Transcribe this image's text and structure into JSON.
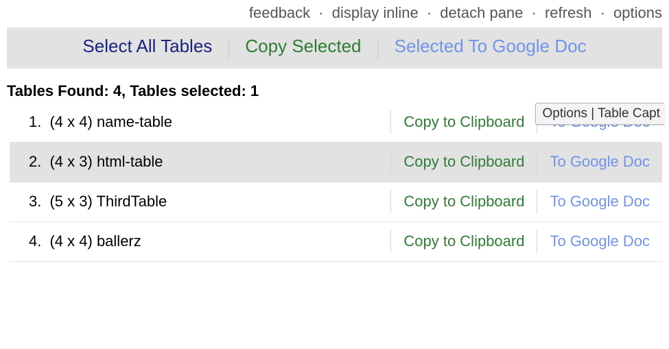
{
  "top_links": {
    "feedback": "feedback",
    "display_inline": "display inline",
    "detach_pane": "detach pane",
    "refresh": "refresh",
    "options": "options",
    "separator": "·"
  },
  "action_bar": {
    "select_all": "Select All Tables",
    "copy_selected": "Copy Selected",
    "to_google_doc": "Selected To Google Doc"
  },
  "status_text": "Tables Found: 4, Tables selected: 1",
  "row_action_labels": {
    "copy": "Copy to Clipboard",
    "gdoc": "To Google Doc"
  },
  "rows": [
    {
      "num": "1.",
      "label": "(4 x 4) name-table",
      "selected": false
    },
    {
      "num": "2.",
      "label": "(4 x 3) html-table",
      "selected": true
    },
    {
      "num": "3.",
      "label": "(5 x 3) ThirdTable",
      "selected": false
    },
    {
      "num": "4.",
      "label": "(4 x 4) ballerz",
      "selected": false
    }
  ],
  "tooltip": "Options | Table Capt"
}
